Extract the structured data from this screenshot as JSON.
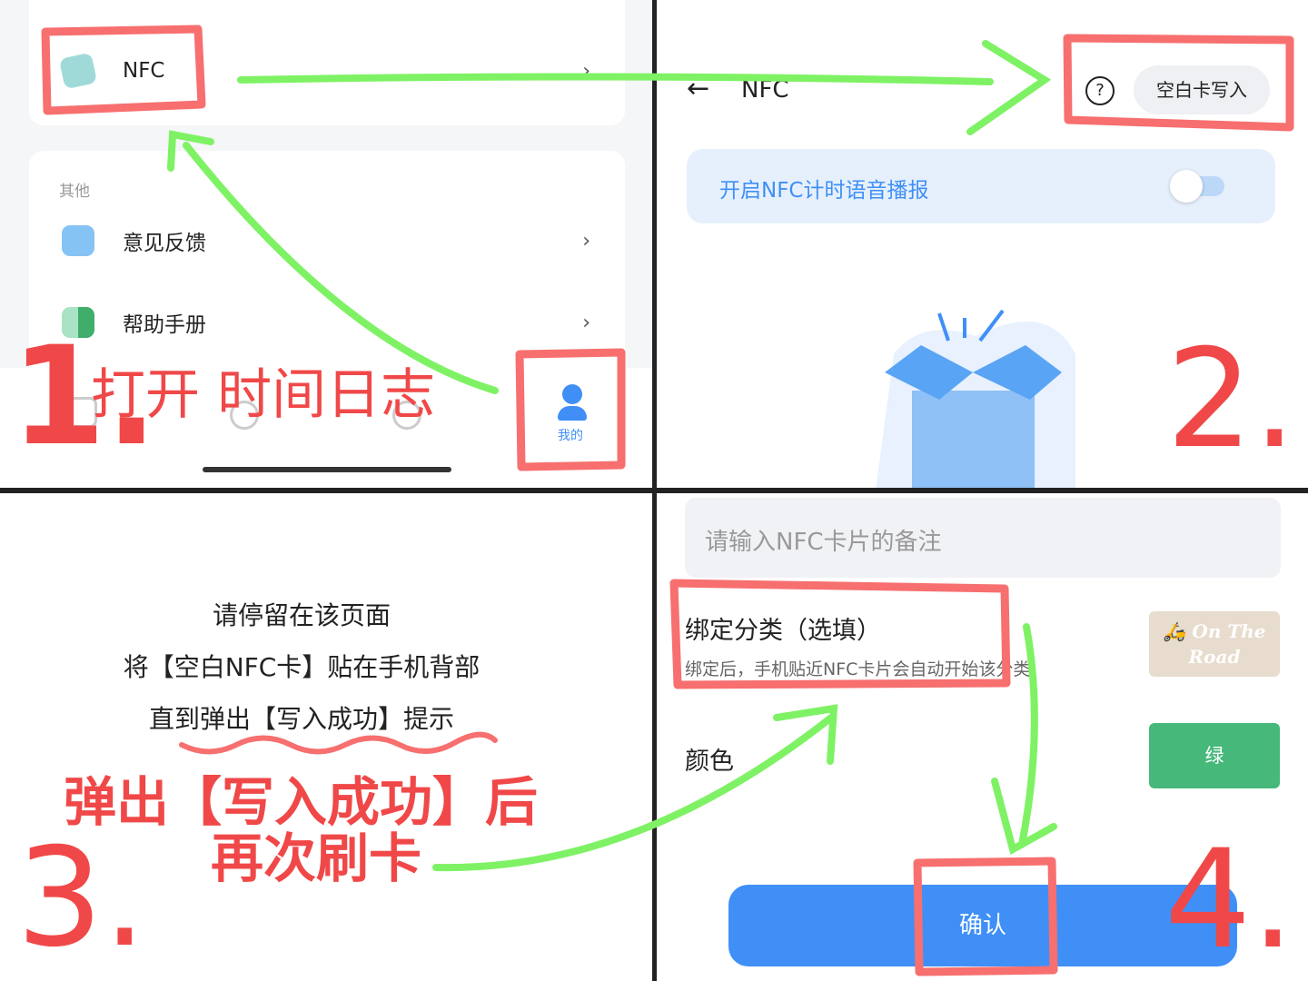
{
  "step1": {
    "nfc_label": "NFC",
    "section_label": "其他",
    "items": [
      {
        "label": "意见反馈",
        "icon": "chat-bubble-icon"
      },
      {
        "label": "帮助手册",
        "icon": "book-icon"
      }
    ],
    "tab_mine_label": "我的",
    "step_number": "1.",
    "annotation": "打开 时间日志"
  },
  "step2": {
    "title": "NFC",
    "blank_card_write_label": "空白卡写入",
    "voice_toggle_label": "开启NFC计时语音播报",
    "voice_toggle_on": false,
    "step_number": "2."
  },
  "step3": {
    "lines": [
      "请停留在该页面",
      "将【空白NFC卡】贴在手机背部",
      "直到弹出【写入成功】提示"
    ],
    "annotation_line1": "弹出【写入成功】后",
    "annotation_line2": "再次刷卡",
    "step_number": "3."
  },
  "step4": {
    "note_placeholder": "请输入NFC卡片的备注",
    "bind_category_label": "绑定分类（选填）",
    "bind_category_hint": "绑定后，手机贴近NFC卡片会自动开始该分类",
    "category_value": "On The Road",
    "color_label": "颜色",
    "color_value": "绿",
    "confirm_label": "确认",
    "step_number": "4."
  },
  "colors": {
    "accent_blue": "#3f8ff7",
    "annotation_red": "#f04848",
    "annotation_green": "#7ef264",
    "color_green": "#46b97a"
  }
}
